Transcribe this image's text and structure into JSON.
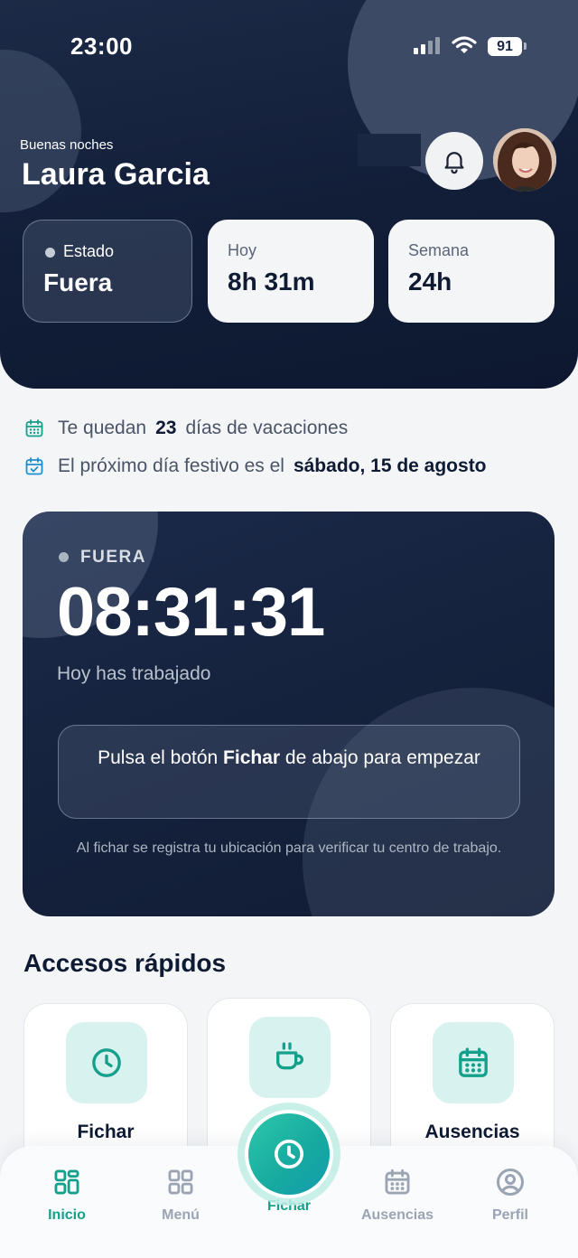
{
  "status_bar": {
    "time": "23:00",
    "battery": "91"
  },
  "header": {
    "greeting": "Buenas noches",
    "user_name": "Laura Garcia",
    "stats": [
      {
        "label": "Estado",
        "value": "Fuera"
      },
      {
        "label": "Hoy",
        "value": "8h 31m"
      },
      {
        "label": "Semana",
        "value": "24h"
      }
    ]
  },
  "info": {
    "vacation_prefix": "Te quedan",
    "vacation_days": "23",
    "vacation_suffix": "días de vacaciones",
    "holiday_prefix": "El próximo día festivo es el",
    "holiday_date": "sábado, 15 de agosto"
  },
  "timer": {
    "status": "FUERA",
    "clock": "08:31:31",
    "caption": "Hoy has trabajado",
    "hint_prefix": "Pulsa el botón",
    "hint_bold": "Fichar",
    "hint_suffix": "de abajo para empezar",
    "note": "Al fichar se registra tu ubicación para verificar tu centro de trabajo."
  },
  "quick_access": {
    "title": "Accesos rápidos",
    "items": [
      {
        "label": "Fichar",
        "icon": "clock-icon"
      },
      {
        "label": "",
        "icon": "coffee-icon"
      },
      {
        "label": "Ausencias",
        "icon": "calendar-icon"
      }
    ]
  },
  "nav": {
    "items": [
      {
        "label": "Inicio",
        "icon": "dashboard-icon",
        "active": true
      },
      {
        "label": "Menú",
        "icon": "grid-icon"
      },
      {
        "label": "Fichar",
        "icon": "clock-icon"
      },
      {
        "label": "Ausencias",
        "icon": "calendar-icon"
      },
      {
        "label": "Perfil",
        "icon": "user-icon"
      }
    ]
  },
  "colors": {
    "accent": "#14a08a",
    "header_bg": "#121e38",
    "tile_bg": "#d8f3ef"
  }
}
